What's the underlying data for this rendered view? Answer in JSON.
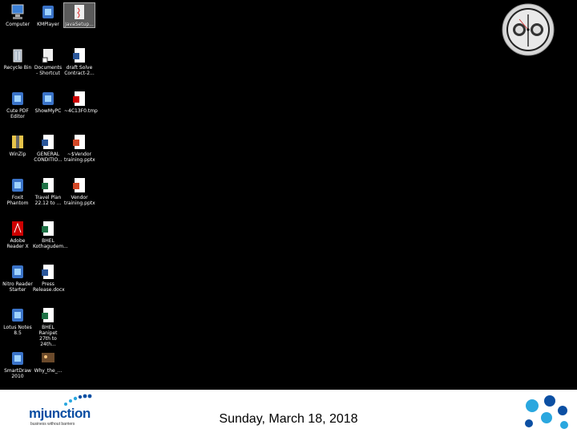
{
  "desktop": {
    "icons": [
      {
        "label": "Computer",
        "kind": "computer"
      },
      {
        "label": "KMPlayer",
        "kind": "app"
      },
      {
        "label": "JavaSetup...",
        "kind": "java",
        "selected": true
      },
      {
        "label": "Recycle Bin",
        "kind": "bin"
      },
      {
        "label": "Documents - Shortcut",
        "kind": "shortcut"
      },
      {
        "label": "draft Solve Contract-2...",
        "kind": "word"
      },
      {
        "label": "Cute PDF Editor",
        "kind": "app"
      },
      {
        "label": "ShowMyPC",
        "kind": "app"
      },
      {
        "label": "~4C13F0.tmp",
        "kind": "pdf"
      },
      {
        "label": "WinZip",
        "kind": "zip"
      },
      {
        "label": "GENERAL CONDITIO...",
        "kind": "word"
      },
      {
        "label": "~$Vendor training.pptx",
        "kind": "ppt"
      },
      {
        "label": "Foxit Phantom",
        "kind": "app"
      },
      {
        "label": "Travel Plan 22.12 to ...",
        "kind": "excel"
      },
      {
        "label": "Vendor training.pptx",
        "kind": "ppt"
      },
      {
        "label": "Adobe Reader X",
        "kind": "adobe"
      },
      {
        "label": "BHEL Kothagudem...",
        "kind": "excel"
      },
      {
        "label": "Nitro Reader Starter",
        "kind": "app"
      },
      {
        "label": "Press Release.docx",
        "kind": "word"
      },
      {
        "label": "Lotus Notes 8.5",
        "kind": "app"
      },
      {
        "label": "BHEL Ranipet 27th to 24th...",
        "kind": "excel"
      },
      {
        "label": "SmartDraw 2010",
        "kind": "app"
      },
      {
        "label": "Why_the_...",
        "kind": "image"
      }
    ]
  },
  "colors": {
    "brand_blue": "#0b4fa3",
    "accent_cyan": "#2aa7df"
  },
  "footer": {
    "date": "Sunday, March 18, 2018",
    "logo_brand": "mjunction",
    "logo_tagline": "business without barriers"
  }
}
